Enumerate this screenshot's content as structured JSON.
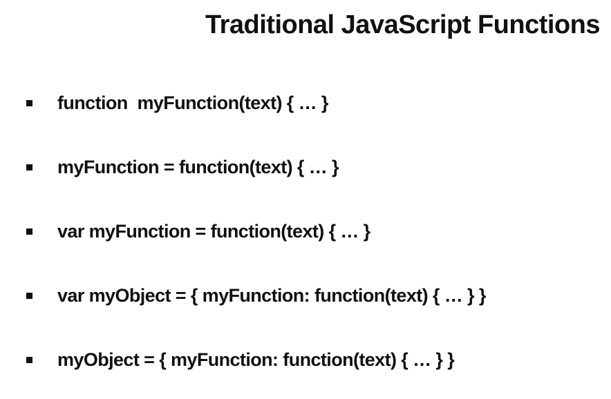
{
  "slide": {
    "title": "Traditional JavaScript Functions",
    "bullets": [
      "function  myFunction(text) { … }",
      "myFunction = function(text) { … }",
      "var myFunction = function(text) { … }",
      "var myObject = { myFunction: function(text) { … } }",
      "myObject = { myFunction: function(text) { … } }"
    ]
  }
}
